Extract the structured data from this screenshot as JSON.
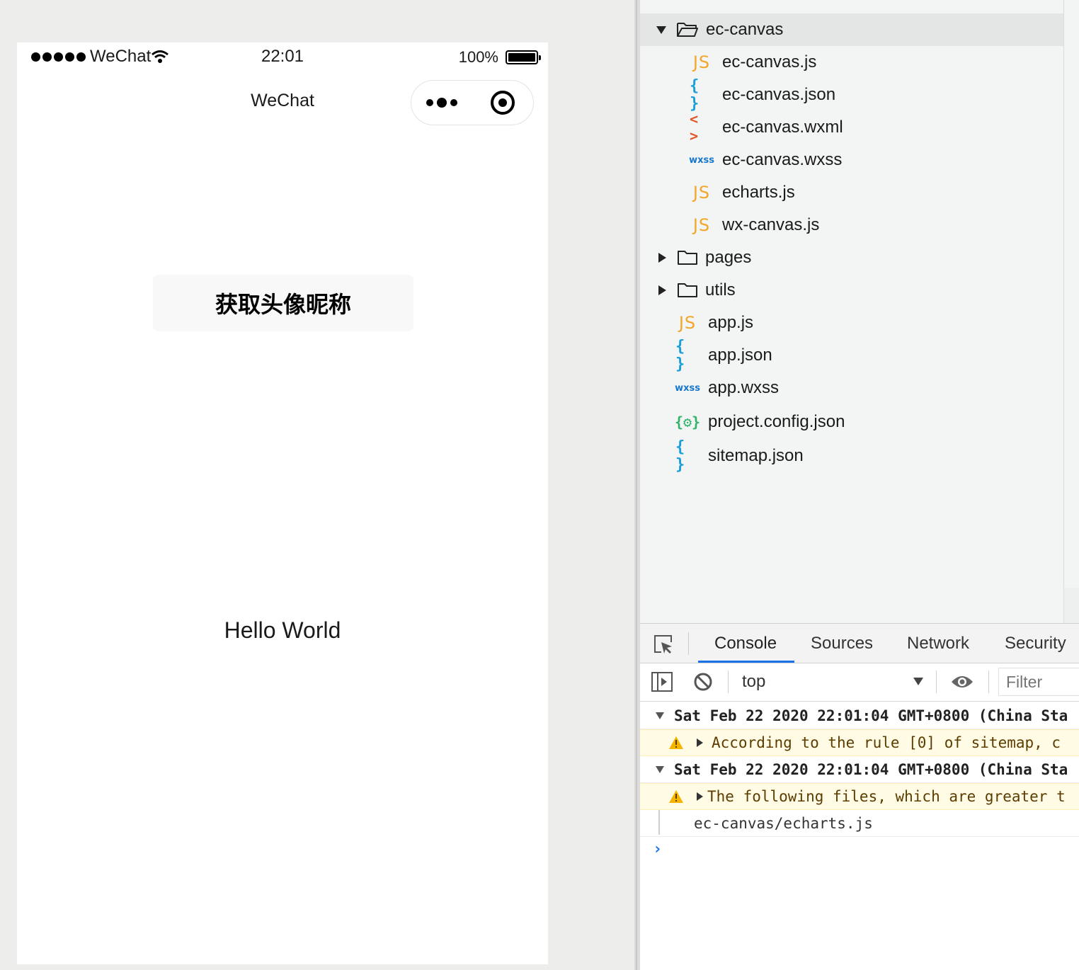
{
  "simulator": {
    "status": {
      "carrier": "WeChat",
      "time": "22:01",
      "battery": "100%"
    },
    "nav_title": "WeChat",
    "button_label": "获取头像昵称",
    "hello_text": "Hello World"
  },
  "explorer": {
    "items": [
      {
        "name": "ec-canvas",
        "type": "folder-open"
      },
      {
        "name": "ec-canvas.js",
        "type": "js",
        "icon": "JS"
      },
      {
        "name": "ec-canvas.json",
        "type": "json",
        "icon": "{ }"
      },
      {
        "name": "ec-canvas.wxml",
        "type": "wxml",
        "icon": "< >"
      },
      {
        "name": "ec-canvas.wxss",
        "type": "wxss",
        "icon": "wxss"
      },
      {
        "name": "echarts.js",
        "type": "js",
        "icon": "JS"
      },
      {
        "name": "wx-canvas.js",
        "type": "js",
        "icon": "JS"
      },
      {
        "name": "pages",
        "type": "folder"
      },
      {
        "name": "utils",
        "type": "folder"
      },
      {
        "name": "app.js",
        "type": "js",
        "icon": "JS"
      },
      {
        "name": "app.json",
        "type": "json",
        "icon": "{ }"
      },
      {
        "name": "app.wxss",
        "type": "wxss",
        "icon": "wxss"
      },
      {
        "name": "project.config.json",
        "type": "proj",
        "icon": "{⚙}"
      },
      {
        "name": "sitemap.json",
        "type": "json",
        "icon": "{ }"
      }
    ]
  },
  "devtools": {
    "tabs": [
      "Console",
      "Sources",
      "Network",
      "Security"
    ],
    "active_tab": "Console",
    "context": "top",
    "filter_placeholder": "Filter",
    "logs": {
      "group1": "Sat Feb 22 2020 22:01:04 GMT+0800 (China Sta",
      "warn1": "According to the rule [0] of sitemap, c",
      "group2": "Sat Feb 22 2020 22:01:04 GMT+0800 (China Sta",
      "warn2": "The following files, which are greater t",
      "file": "ec-canvas/echarts.js"
    },
    "prompt": "›"
  },
  "colors": {
    "accent": "#1a73e8",
    "js": "#f2a72a",
    "json": "#1b9fd8",
    "wxml": "#e0582a",
    "wxss": "#1777c9",
    "warn_bg": "#fffbe5"
  }
}
